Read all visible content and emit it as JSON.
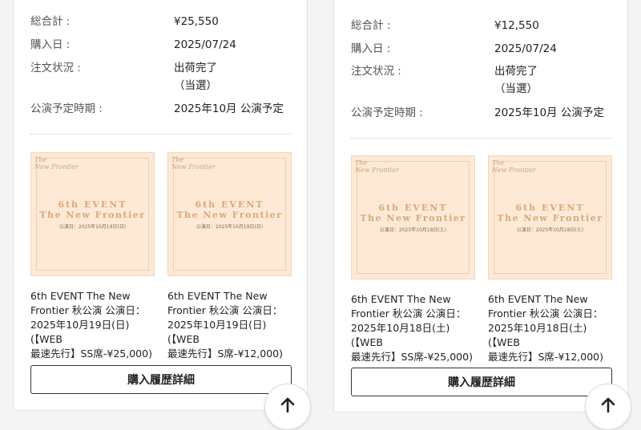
{
  "orders": [
    {
      "total_label": "総合計 :",
      "total_value": "¥25,550",
      "date_label": "購入日 :",
      "date_value": "2025/07/24",
      "status_label": "注文状況 :",
      "status_value_1": "出荷完了",
      "status_value_2": "（当選）",
      "schedule_label": "公演予定時期 :",
      "schedule_value": "2025年10月 公演予定",
      "items": [
        {
          "thumb_logo_1": "The",
          "thumb_logo_2": "New Frontier",
          "thumb_title_1": "6th EVENT",
          "thumb_title_2": "The New Frontier",
          "thumb_date": "公演日：2025年10月19日(日)",
          "name_1": "6th EVENT The New",
          "name_2": "Frontier 秋公演 公演日：",
          "name_3": "2025年10月19日(日)(【WEB",
          "name_4": "最速先行】SS席-¥25,000)"
        },
        {
          "thumb_logo_1": "The",
          "thumb_logo_2": "New Frontier",
          "thumb_title_1": "6th EVENT",
          "thumb_title_2": "The New Frontier",
          "thumb_date": "公演日：2025年10月19日(日)",
          "name_1": "6th EVENT The New",
          "name_2": "Frontier 秋公演 公演日：",
          "name_3": "2025年10月19日(日)(【WEB",
          "name_4": "最速先行】S席-¥12,000)"
        }
      ],
      "detail_button": "購入履歴詳細"
    },
    {
      "total_label": "総合計 :",
      "total_value": "¥12,550",
      "date_label": "購入日 :",
      "date_value": "2025/07/24",
      "status_label": "注文状況 :",
      "status_value_1": "出荷完了",
      "status_value_2": "（当選）",
      "schedule_label": "公演予定時期 :",
      "schedule_value": "2025年10月 公演予定",
      "items": [
        {
          "thumb_logo_1": "The",
          "thumb_logo_2": "New Frontier",
          "thumb_title_1": "6th EVENT",
          "thumb_title_2": "The New Frontier",
          "thumb_date": "公演日：2025年10月18日(土)",
          "name_1": "6th EVENT The New",
          "name_2": "Frontier 秋公演 公演日：",
          "name_3": "2025年10月18日(土)(【WEB",
          "name_4": "最速先行】SS席-¥25,000)"
        },
        {
          "thumb_logo_1": "The",
          "thumb_logo_2": "New Frontier",
          "thumb_title_1": "6th EVENT",
          "thumb_title_2": "The New Frontier",
          "thumb_date": "公演日：2025年10月18日(土)",
          "name_1": "6th EVENT The New",
          "name_2": "Frontier 秋公演 公演日：",
          "name_3": "2025年10月18日(土)(【WEB",
          "name_4": "最速先行】S席-¥12,000)"
        }
      ],
      "detail_button": "購入履歴詳細"
    }
  ],
  "scroll_top_icon": "arrow-up-icon"
}
